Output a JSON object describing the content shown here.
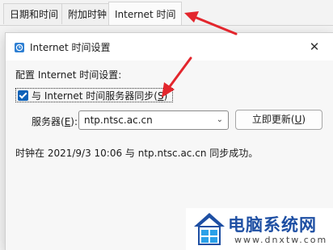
{
  "tabs": [
    {
      "label": "日期和时间"
    },
    {
      "label": "附加时钟"
    },
    {
      "label": "Internet 时间"
    }
  ],
  "dialog": {
    "title": "Internet 时间设置",
    "close_icon": "close-icon",
    "config_label": "配置 Internet 时间设置:",
    "sync_checkbox": {
      "checked": true,
      "label_prefix": "与 Internet 时间服务器同步(",
      "accesskey": "S",
      "label_suffix": ")"
    },
    "server_label_prefix": "服务器(",
    "server_accesskey": "E",
    "server_label_suffix": "):",
    "server_value": "ntp.ntsc.ac.cn",
    "update_prefix": "立即更新(",
    "update_accesskey": "U",
    "update_suffix": ")",
    "status": "时钟在 2021/9/3 10:06 与 ntp.ntsc.ac.cn 同步成功。"
  },
  "watermark": {
    "name": "电脑系统网",
    "url": "www.dnxtw.com"
  },
  "colors": {
    "accent": "#0f62b8",
    "arrow": "#e3262d",
    "brand": "#1e4fa3"
  }
}
